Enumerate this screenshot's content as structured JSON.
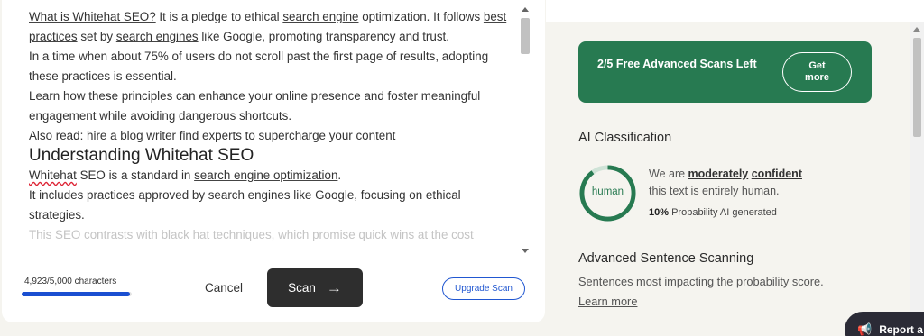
{
  "editor": {
    "p1": {
      "l1": "What is Whitehat SEO?",
      "t1": " It is a pledge to ethical ",
      "l2": "search engine",
      "t2": " optimization. It follows ",
      "l3": "best practices",
      "t3": " set by ",
      "l4": "search engines",
      "t4": " like Google, promoting transparency and trust."
    },
    "p2": "In a time when about 75% of users do not scroll past the first page of results, adopting these practices is essential.",
    "p3": "Learn how these principles can enhance your online presence and foster meaningful engagement while avoiding dangerous shortcuts.",
    "p4": {
      "t1": "Also read: ",
      "l1": "hire a blog writer find experts to supercharge your content"
    },
    "heading": "Understanding Whitehat SEO",
    "p5": {
      "w1": "Whitehat",
      "t1": " SEO is a standard in ",
      "l1": "search engine optimization",
      "t2": "."
    },
    "p6": "It includes practices approved by search engines like Google, focusing on ethical strategies.",
    "p7": "This SEO contrasts with black hat techniques, which promise quick wins at the cost"
  },
  "footer": {
    "char_count": "4,923/5,000 characters",
    "char_fraction": 0.9846,
    "cancel_label": "Cancel",
    "scan_label": "Scan",
    "upgrade_label": "Upgrade Scan"
  },
  "promo": {
    "text": "2/5 Free Advanced Scans Left",
    "button_line1": "Get",
    "button_line2": "more"
  },
  "ai_classification": {
    "title": "AI Classification",
    "ring_label": "human",
    "ring_fraction": 0.9,
    "line1_a": "We are ",
    "line1_b": "moderately",
    "line1_c": "confident",
    "line2": "this text is entirely human.",
    "prob_value": "10%",
    "prob_text": " Probability AI generated"
  },
  "advanced": {
    "title": "Advanced Sentence Scanning",
    "subtext": "Sentences most impacting the probability score.",
    "learn_more": "Learn more"
  },
  "report": {
    "label": "Report a"
  },
  "colors": {
    "accent_green": "#277a51",
    "ring_track": "#cfe3d7",
    "link_blue": "#2157d1",
    "progress_blue": "#1a4fd1",
    "scan_button": "#2e2e2e"
  }
}
